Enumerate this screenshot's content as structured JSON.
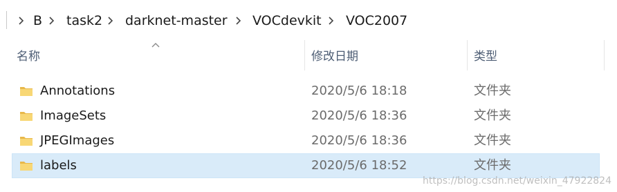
{
  "breadcrumb": {
    "items": [
      "B",
      "task2",
      "darknet-master",
      "VOCdevkit",
      "VOC2007"
    ]
  },
  "columns": {
    "name": "名称",
    "date": "修改日期",
    "type": "类型"
  },
  "rows": [
    {
      "name": "Annotations",
      "date": "2020/5/6 18:18",
      "type": "文件夹",
      "icon": "folder-icon",
      "selected": false
    },
    {
      "name": "ImageSets",
      "date": "2020/5/6 18:36",
      "type": "文件夹",
      "icon": "folder-icon",
      "selected": false
    },
    {
      "name": "JPEGImages",
      "date": "2020/5/6 18:36",
      "type": "文件夹",
      "icon": "folder-icon",
      "selected": false
    },
    {
      "name": "labels",
      "date": "2020/5/6 18:52",
      "type": "文件夹",
      "icon": "folder-icon",
      "selected": true
    }
  ],
  "colors": {
    "folder": "#f8d775",
    "folder_dark": "#e8b84a",
    "selection": "#d9ebf9",
    "header_text": "#4d5d74"
  },
  "watermark": "https://blog.csdn.net/weixin_47922824"
}
